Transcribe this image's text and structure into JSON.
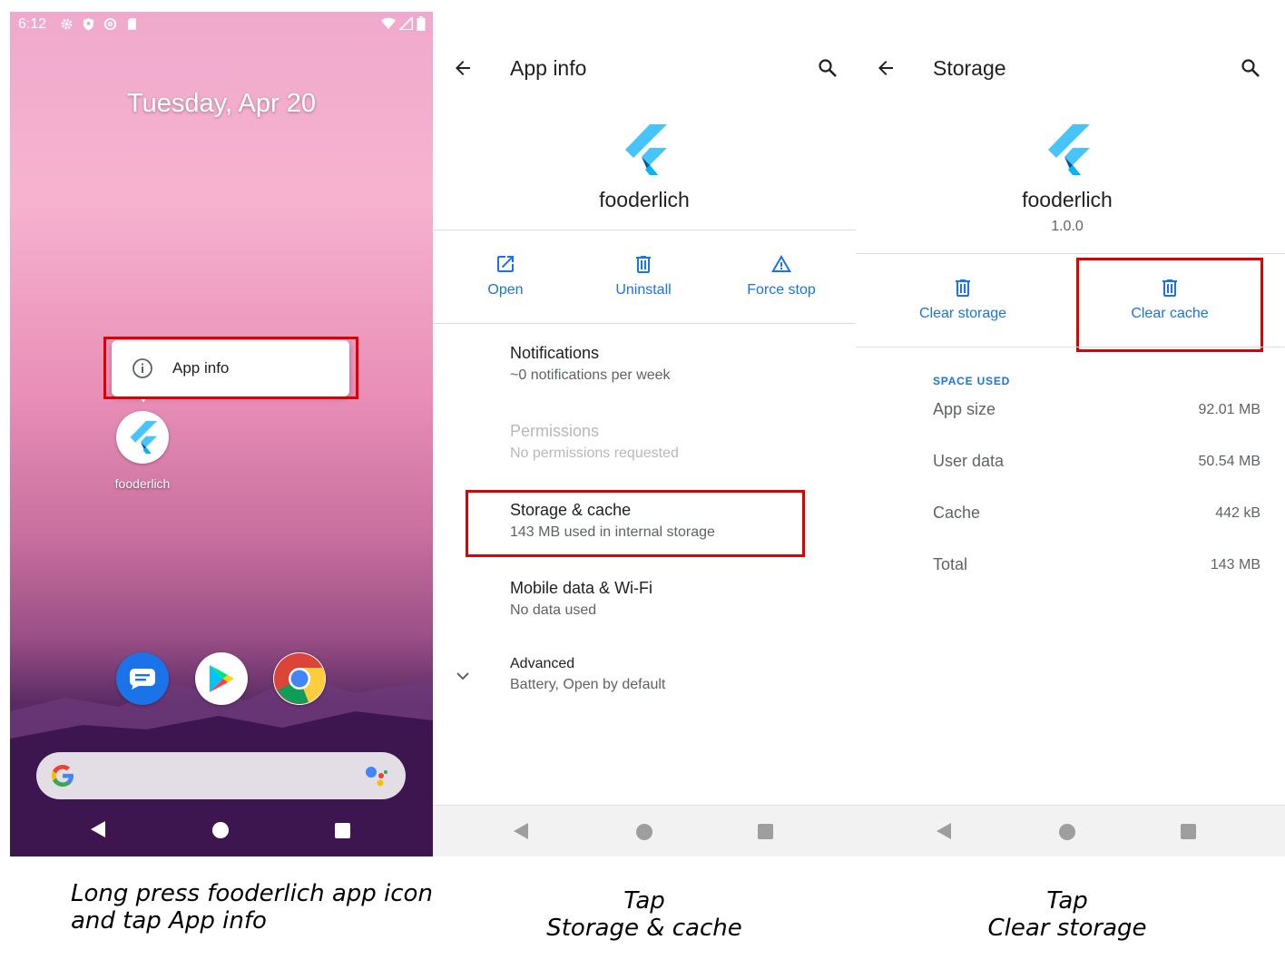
{
  "home": {
    "time": "6:12",
    "date": "Tuesday, Apr 20",
    "popup_label": "App info",
    "app_label": "fooderlich",
    "caption_line1": "Long press fooderlich app icon",
    "caption_line2": "and tap App info"
  },
  "app_info": {
    "title": "App info",
    "app_name": "fooderlich",
    "actions": [
      "Open",
      "Uninstall",
      "Force stop"
    ],
    "rows": [
      {
        "title": "Notifications",
        "subtitle": "~0 notifications per week"
      },
      {
        "title": "Permissions",
        "subtitle": "No permissions requested"
      },
      {
        "title": "Storage & cache",
        "subtitle": "143 MB used in internal storage"
      },
      {
        "title": "Mobile data & Wi-Fi",
        "subtitle": "No data used"
      },
      {
        "title": "Advanced",
        "subtitle": "Battery, Open by default"
      }
    ],
    "caption_line1": "Tap",
    "caption_line2": "Storage & cache"
  },
  "storage": {
    "title": "Storage",
    "app_name": "fooderlich",
    "version": "1.0.0",
    "actions": [
      "Clear storage",
      "Clear cache"
    ],
    "section_header": "SPACE USED",
    "rows": [
      {
        "label": "App size",
        "value": "92.01 MB"
      },
      {
        "label": "User data",
        "value": "50.54 MB"
      },
      {
        "label": "Cache",
        "value": "442 kB"
      },
      {
        "label": "Total",
        "value": "143 MB"
      }
    ],
    "caption_line1": "Tap",
    "caption_line2": "Clear storage"
  },
  "colors": {
    "accent": "#1a73e8",
    "highlight": "#e10000",
    "flutter_light": "#47c5fb",
    "flutter_dark": "#00569e"
  },
  "icons": [
    "settings-icon",
    "shield-icon",
    "at-icon",
    "sd-card-icon",
    "wifi-icon",
    "signal-icon",
    "battery-icon",
    "info-icon",
    "flutter-logo-icon",
    "messages-icon",
    "play-store-icon",
    "chrome-icon",
    "google-icon",
    "assistant-icon",
    "back-arrow-icon",
    "search-icon",
    "open-external-icon",
    "trash-icon",
    "warning-icon",
    "chevron-down-icon"
  ]
}
